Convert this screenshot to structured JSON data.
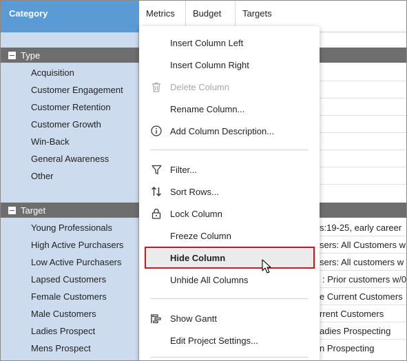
{
  "category_header": "Category",
  "columns": [
    "Metrics",
    "Budget",
    "Targets"
  ],
  "groups": [
    {
      "label": "Type",
      "items": [
        "Acquisition",
        "Customer Engagement",
        "Customer Retention",
        "Customer Growth",
        "Win-Back",
        "General Awareness",
        "Other"
      ]
    },
    {
      "label": "Target",
      "items": [
        "Young Professionals",
        "High Active Purchasers",
        "Low Active Purchasers",
        "Lapsed Customers",
        "Female Customers",
        "Male Customers",
        "Ladies Prospect",
        "Mens Prospect"
      ]
    }
  ],
  "target_cells": [
    "s:19-25, early career",
    "sers: All Customers w",
    "sers: All customers w",
    ": Prior customers w/0",
    "e Current Customers",
    "rrent Customers",
    "adies Prospecting",
    "n Prospecting"
  ],
  "context_menu": {
    "items": [
      {
        "label": "Insert Column Left",
        "icon": "",
        "disabled": false
      },
      {
        "label": "Insert Column Right",
        "icon": "",
        "disabled": false
      },
      {
        "label": "Delete Column",
        "icon": "trash-icon",
        "disabled": true
      },
      {
        "label": "Rename Column...",
        "icon": "",
        "disabled": false
      },
      {
        "label": "Add Column Description...",
        "icon": "info-icon",
        "disabled": false
      },
      {
        "label": "Filter...",
        "icon": "filter-icon",
        "disabled": false
      },
      {
        "label": "Sort Rows...",
        "icon": "sort-icon",
        "disabled": false
      },
      {
        "label": "Lock Column",
        "icon": "lock-icon",
        "disabled": false
      },
      {
        "label": "Freeze Column",
        "icon": "",
        "disabled": false
      },
      {
        "label": "Hide Column",
        "icon": "",
        "disabled": false,
        "highlighted": true
      },
      {
        "label": "Unhide All Columns",
        "icon": "",
        "disabled": false
      },
      {
        "label": "Show Gantt",
        "icon": "gantt-icon",
        "disabled": false
      },
      {
        "label": "Edit Project Settings...",
        "icon": "",
        "disabled": false
      }
    ]
  },
  "colors": {
    "header_blue": "#5b9bd5",
    "category_bg": "#ccdcee",
    "group_bg": "#6e6e6e",
    "highlight_border": "#d3141b"
  }
}
